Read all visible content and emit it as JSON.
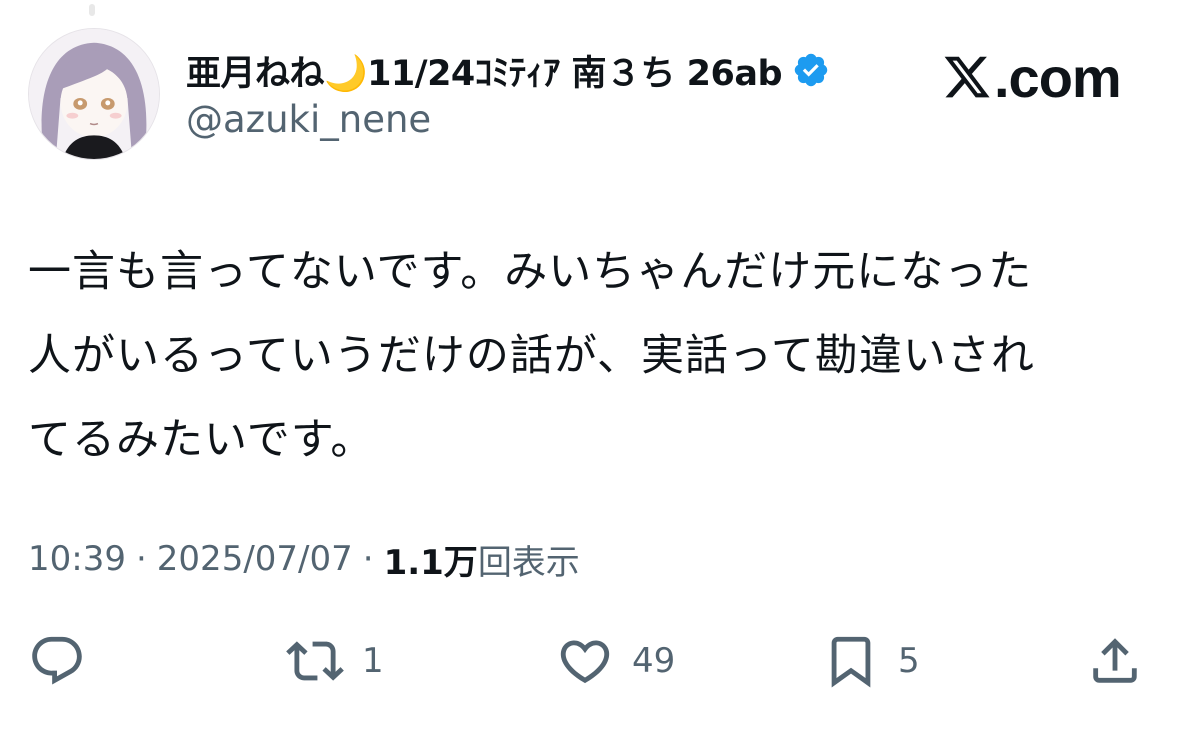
{
  "tweet": {
    "author": {
      "display_name": "亜月ねね🌙11/24ｺﾐﾃｨｱ 南３ち 26ab",
      "handle": "@azuki_nene",
      "verified_icon": "verified-badge-icon",
      "verified_color": "#1d9bf0"
    },
    "brand": "X.com",
    "brand_suffix": ".com",
    "text_lines": [
      "一言も言ってないです。みいちゃんだけ元になった",
      "人がいるっていうだけの話が、実話って勘違いされ",
      "てるみたいです。"
    ],
    "meta": {
      "time": "10:39",
      "separator": "·",
      "date": "2025/07/07",
      "views_count": "1.1万",
      "views_label": "回表示"
    },
    "actions": {
      "reply": {
        "icon": "reply-icon",
        "count": ""
      },
      "retweet": {
        "icon": "retweet-icon",
        "count": "1"
      },
      "like": {
        "icon": "heart-icon",
        "count": "49"
      },
      "bookmark": {
        "icon": "bookmark-icon",
        "count": "5"
      },
      "share": {
        "icon": "share-icon",
        "count": ""
      }
    }
  },
  "colors": {
    "text_primary": "#0f1419",
    "text_secondary": "#536471",
    "background": "#ffffff"
  }
}
